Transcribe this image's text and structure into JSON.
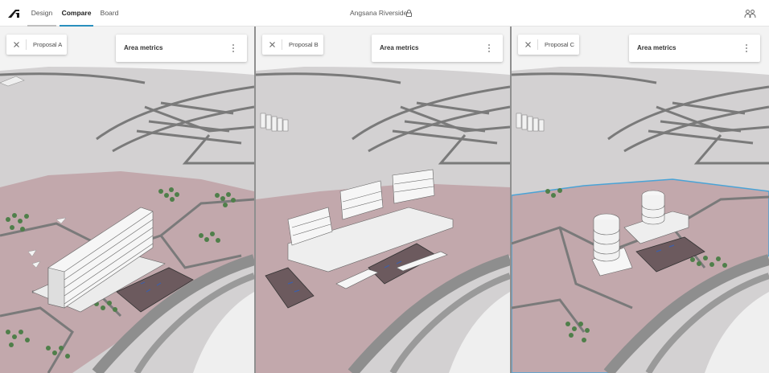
{
  "app": {
    "tabs": [
      {
        "label": "Design",
        "active": false
      },
      {
        "label": "Compare",
        "active": true
      },
      {
        "label": "Board",
        "active": false
      }
    ],
    "project_title": "Angsana Riverside",
    "icons": {
      "logo": "autodesk-logo-icon",
      "lock": "lock-icon",
      "collaborators": "people-icon"
    }
  },
  "colors": {
    "accent": "#2a8fbd",
    "site_pink": "#c2a8ac",
    "road": "#7a7a7a",
    "ground": "#d3d1d2",
    "water": "#f2f2f2",
    "building": "#f4f4f4",
    "tree": "#4f7f4a",
    "boundary": "#4aa3d6"
  },
  "panels": [
    {
      "proposal_label": "Proposal A",
      "metrics_title": "Area metrics",
      "close_icon": "close-icon",
      "menu_icon": "more-vertical-icon"
    },
    {
      "proposal_label": "Proposal B",
      "metrics_title": "Area metrics",
      "close_icon": "close-icon",
      "menu_icon": "more-vertical-icon"
    },
    {
      "proposal_label": "Proposal C",
      "metrics_title": "Area metrics",
      "close_icon": "close-icon",
      "menu_icon": "more-vertical-icon"
    }
  ]
}
